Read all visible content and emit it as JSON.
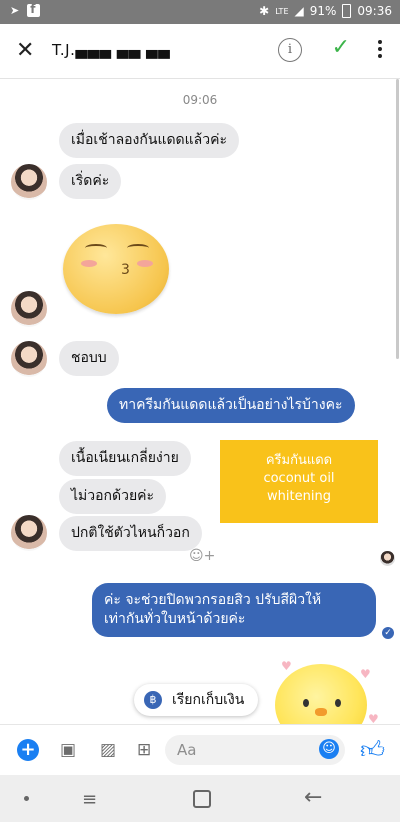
{
  "status_bar": {
    "battery": "91%",
    "time": "09:36",
    "network": "LTE"
  },
  "header": {
    "title": "T.J.▄▄▄ ▄▄ ▄▄",
    "info_icon": "i"
  },
  "chat": {
    "timestamp": "09:06",
    "messages": [
      {
        "from": "them",
        "text": "เมื่อเช้าลองกันแดดแล้วค่ะ"
      },
      {
        "from": "them",
        "text": "เริ่ดค่ะ"
      },
      {
        "from": "them",
        "text": "ชอบบ"
      },
      {
        "from": "me",
        "text": "ทาครีมกันแดดแล้วเป็นอย่างไรบ้างคะ"
      },
      {
        "from": "them",
        "text": "เนื้อเนียนเกลี่ยง่าย"
      },
      {
        "from": "them",
        "text": "ไม่วอกด้วยค่ะ"
      },
      {
        "from": "them",
        "text": "ปกติใช้ตัวไหนก็วอก"
      },
      {
        "from": "me",
        "line1": "ค่ะ จะช่วยปิดพวกรอยสิว ปรับสีผิวให้",
        "line2": "เท่ากันทั่วใบหน้าด้วยค่ะ"
      }
    ],
    "product_note": {
      "line1": "ครีมกันแดด",
      "line2": "coconut oil",
      "line3": "whitening"
    },
    "collect_button": {
      "label": "เรียกเก็บเงิน",
      "currency": "฿"
    }
  },
  "composer": {
    "placeholder": "Aa"
  },
  "colors": {
    "accent": "#1a7ff2",
    "outgoing": "#3966b5",
    "note": "#f9c21a"
  }
}
